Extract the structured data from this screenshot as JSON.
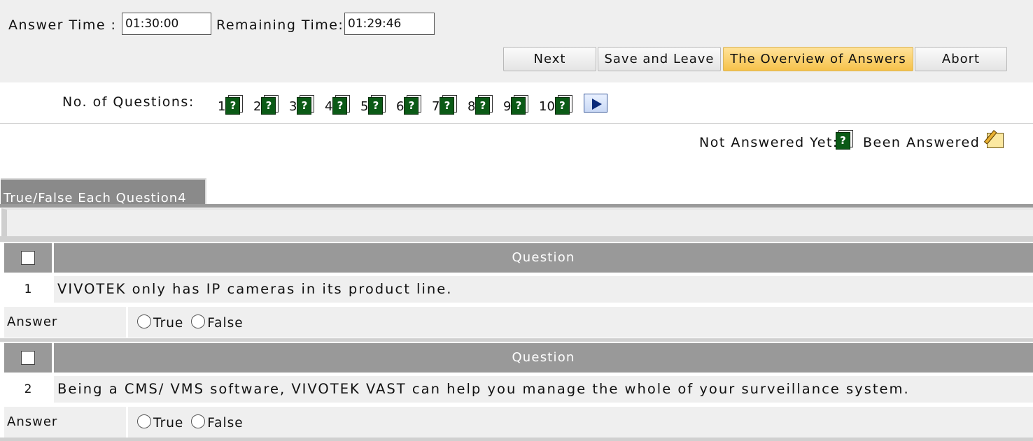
{
  "timer": {
    "answer_time_label": "Answer Time :",
    "answer_time_value": "01:30:00",
    "remaining_time_label": "Remaining Time:",
    "remaining_time_value": "01:29:46"
  },
  "actions": {
    "next_label": "Next",
    "save_leave_label": "Save and Leave",
    "overview_label": "The Overview of Answers",
    "abort_label": "Abort"
  },
  "navigator": {
    "label": "No. of Questions:",
    "questions": [
      "1",
      "2",
      "3",
      "4",
      "5",
      "6",
      "7",
      "8",
      "9",
      "10"
    ],
    "question_icon": "green-book-question-icon",
    "next_page_icon": "play-arrow-icon"
  },
  "legend": {
    "not_answered_label": "Not Answered Yet:",
    "answered_label": "Been Answered :",
    "not_answered_icon": "green-book-question-icon",
    "answered_icon": "notepad-pencil-icon"
  },
  "section": {
    "tab_label": "True/False Each Question4"
  },
  "question_header_label": "Question",
  "answer_label": "Answer",
  "questions": [
    {
      "number": "1",
      "text": "VIVOTEK only has IP cameras in its product line.",
      "options": [
        "True",
        "False"
      ]
    },
    {
      "number": "2",
      "text": "Being a CMS/ VMS software, VIVOTEK VAST can help you manage the whole of your surveillance system.",
      "options": [
        "True",
        "False"
      ]
    }
  ],
  "colors": {
    "panel_bg": "#efefef",
    "header_gray": "#999999",
    "tab_gray": "#8a8a8a",
    "highlight_button": "#f6c24a",
    "book_green": "#0b5a16"
  }
}
